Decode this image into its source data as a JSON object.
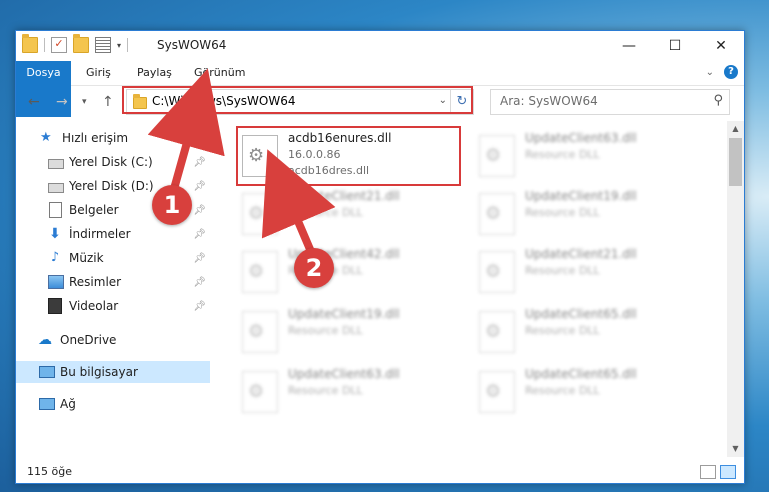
{
  "window": {
    "title": "SysWOW64",
    "controls": {
      "minimize": "—",
      "maximize": "☐",
      "close": "✕"
    }
  },
  "ribbon": {
    "tabs": [
      {
        "label": "Dosya"
      },
      {
        "label": "Giriş"
      },
      {
        "label": "Paylaş"
      },
      {
        "label": "Görünüm"
      }
    ],
    "help": "?"
  },
  "address": {
    "path": "C:\\Windows\\SysWOW64",
    "refresh": "↻"
  },
  "search": {
    "placeholder": "Ara: SysWOW64"
  },
  "nav_pane": {
    "items": [
      {
        "label": "Hızlı erişim",
        "icon": "star-icon",
        "pinned": false
      },
      {
        "label": "Yerel Disk (C:)",
        "icon": "disk-icon",
        "pinned": true
      },
      {
        "label": "Yerel Disk (D:)",
        "icon": "disk-icon",
        "pinned": true
      },
      {
        "label": "Belgeler",
        "icon": "document-icon",
        "pinned": true
      },
      {
        "label": "İndirmeler",
        "icon": "download-icon",
        "pinned": true
      },
      {
        "label": "Müzik",
        "icon": "music-icon",
        "pinned": true
      },
      {
        "label": "Resimler",
        "icon": "pictures-icon",
        "pinned": true
      },
      {
        "label": "Videolar",
        "icon": "videos-icon",
        "pinned": true
      },
      {
        "label": "OneDrive",
        "icon": "cloud-icon",
        "pinned": false
      },
      {
        "label": "Bu bilgisayar",
        "icon": "computer-icon",
        "pinned": false
      },
      {
        "label": "Ağ",
        "icon": "network-icon",
        "pinned": false
      }
    ]
  },
  "files": [
    {
      "name": "acdb16enures.dll",
      "line2": "16.0.0.86",
      "line3": "acdb16dres.dll"
    },
    {
      "name": "UpdateClient63.dll",
      "line2": "Resource DLL"
    },
    {
      "name": "UpdateClient21.dll",
      "line2": "Resource DLL"
    },
    {
      "name": "UpdateClient19.dll",
      "line2": "Resource DLL"
    },
    {
      "name": "UpdateClient42.dll",
      "line2": "Resource DLL"
    },
    {
      "name": "UpdateClient21.dll",
      "line2": "Resource DLL"
    },
    {
      "name": "UpdateClient19.dll",
      "line2": "Resource DLL"
    },
    {
      "name": "UpdateClient65.dll",
      "line2": "Resource DLL"
    },
    {
      "name": "UpdateClient63.dll",
      "line2": "Resource DLL"
    },
    {
      "name": "UpdateClient65.dll",
      "line2": "Resource DLL"
    }
  ],
  "status": {
    "count": "115 öğe"
  },
  "callouts": {
    "one": "1",
    "two": "2"
  },
  "colors": {
    "accent": "#1979ca",
    "annotation_red": "#d83a3a",
    "selection": "#cce8ff"
  }
}
